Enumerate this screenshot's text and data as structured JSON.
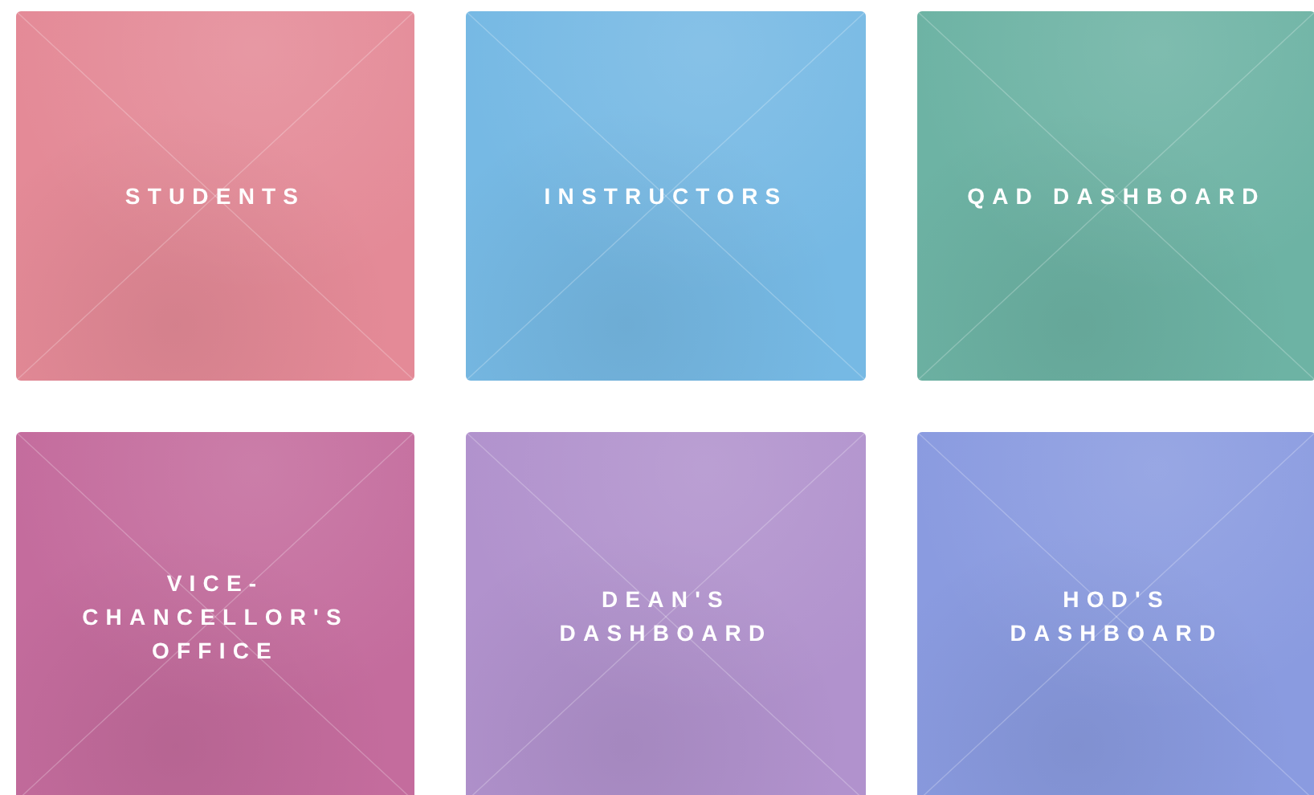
{
  "tiles": [
    {
      "label": "STUDENTS",
      "color": "#e48a97"
    },
    {
      "label": "INSTRUCTORS",
      "color": "#76b9e4"
    },
    {
      "label": "QAD DASHBOARD",
      "color": "#6db3a4"
    },
    {
      "label": "VICE-CHANCELLOR'S OFFICE",
      "color": "#c46c9d"
    },
    {
      "label": "DEAN'S DASHBOARD",
      "color": "#b192cd"
    },
    {
      "label": "HOD'S DASHBOARD",
      "color": "#8a9be0"
    }
  ]
}
